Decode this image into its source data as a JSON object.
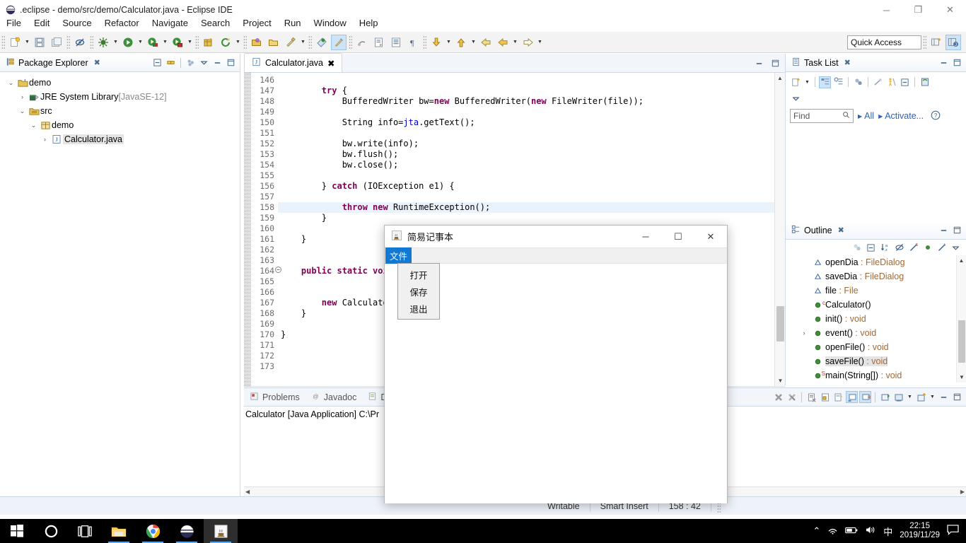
{
  "window": {
    "title": ".eclipse - demo/src/demo/Calculator.java - Eclipse IDE",
    "minimize": "─",
    "restore": "❐",
    "close": "✕"
  },
  "menubar": {
    "items": [
      "File",
      "Edit",
      "Source",
      "Refactor",
      "Navigate",
      "Search",
      "Project",
      "Run",
      "Window",
      "Help"
    ]
  },
  "toolbar": {
    "quick_access": "Quick Access",
    "icons": [
      "new-file-icon",
      "new-dropdown-arrow",
      "save-icon",
      "save-all-icon",
      "toggle-breakpoint-icon",
      "debug-icon",
      "debug-dropdown-arrow",
      "run-icon",
      "run-dropdown-arrow",
      "run-coverage-icon",
      "coverage-dropdown-arrow",
      "external-tools-icon",
      "tools-dropdown-arrow",
      "new-java-project-icon",
      "refresh-icon",
      "refresh-dropdown-arrow",
      "open-type-icon",
      "open-resource-icon",
      "search-icon",
      "search-dropdown-arrow",
      "link-editor-icon",
      "pin-editor-icon",
      "next-annotation-icon",
      "previous-annotation-icon",
      "mark-occurrences-icon",
      "show-whitespace-icon",
      "download-icon",
      "download-dropdown-arrow",
      "upload-icon",
      "upload-dropdown-arrow",
      "back-icon",
      "forward-icon",
      "forward-dropdown-arrow",
      "next-edit-icon",
      "next-dropdown-arrow",
      "perspective-new-icon",
      "perspective-java-icon"
    ]
  },
  "package_explorer": {
    "tab_label": "Package Explorer",
    "tools": [
      "collapse-all-icon",
      "link-with-editor-icon",
      "view-menu-filter-icon",
      "view-menu-icon",
      "minimize-icon",
      "maximize-icon"
    ],
    "tree": [
      {
        "label": "demo",
        "label2": "",
        "indent": 0,
        "twisty": "⌄",
        "icon": "project-folder-icon",
        "selected": false
      },
      {
        "label": "JRE System Library",
        "label2": "[JavaSE-12]",
        "indent": 1,
        "twisty": "›",
        "icon": "library-icon",
        "selected": false
      },
      {
        "label": "src",
        "label2": "",
        "indent": 1,
        "twisty": "⌄",
        "icon": "source-folder-icon",
        "selected": false
      },
      {
        "label": "demo",
        "label2": "",
        "indent": 2,
        "twisty": "⌄",
        "icon": "package-icon",
        "selected": false
      },
      {
        "label": "Calculator.java",
        "label2": "",
        "indent": 3,
        "twisty": "›",
        "icon": "java-file-icon",
        "selected": true
      }
    ]
  },
  "editor": {
    "tab_label": "Calculator.java",
    "tab_icon": "java-file-icon",
    "tab_close": "✖",
    "first_line_number": 146,
    "highlighted_line": 158,
    "folded_lines": [
      164
    ],
    "lines": [
      {
        "n": 146,
        "tokens": []
      },
      {
        "n": 147,
        "tokens": [
          {
            "t": "        ",
            "c": ""
          },
          {
            "t": "try",
            "c": "kw"
          },
          {
            "t": " {",
            "c": ""
          }
        ]
      },
      {
        "n": 148,
        "tokens": [
          {
            "t": "            BufferedWriter bw=",
            "c": ""
          },
          {
            "t": "new",
            "c": "kw"
          },
          {
            "t": " BufferedWriter(",
            "c": ""
          },
          {
            "t": "new",
            "c": "kw"
          },
          {
            "t": " FileWriter(file));",
            "c": ""
          }
        ]
      },
      {
        "n": 149,
        "tokens": []
      },
      {
        "n": 150,
        "tokens": [
          {
            "t": "            String info=",
            "c": ""
          },
          {
            "t": "jta",
            "c": "fld"
          },
          {
            "t": ".getText();",
            "c": ""
          }
        ]
      },
      {
        "n": 151,
        "tokens": []
      },
      {
        "n": 152,
        "tokens": [
          {
            "t": "            bw.write(",
            "c": ""
          },
          {
            "t": "info",
            "c": ""
          },
          {
            "t": ");",
            "c": ""
          }
        ]
      },
      {
        "n": 153,
        "tokens": [
          {
            "t": "            bw.flush();",
            "c": ""
          }
        ]
      },
      {
        "n": 154,
        "tokens": [
          {
            "t": "            bw.close();",
            "c": ""
          }
        ]
      },
      {
        "n": 155,
        "tokens": []
      },
      {
        "n": 156,
        "tokens": [
          {
            "t": "        } ",
            "c": ""
          },
          {
            "t": "catch",
            "c": "kw"
          },
          {
            "t": " (IOException e1) {",
            "c": ""
          }
        ]
      },
      {
        "n": 157,
        "tokens": []
      },
      {
        "n": 158,
        "tokens": [
          {
            "t": "            ",
            "c": ""
          },
          {
            "t": "throw new",
            "c": "kw"
          },
          {
            "t": " RuntimeException();",
            "c": ""
          }
        ]
      },
      {
        "n": 159,
        "tokens": [
          {
            "t": "        }",
            "c": ""
          }
        ]
      },
      {
        "n": 160,
        "tokens": []
      },
      {
        "n": 161,
        "tokens": [
          {
            "t": "    }",
            "c": ""
          }
        ]
      },
      {
        "n": 162,
        "tokens": []
      },
      {
        "n": 163,
        "tokens": []
      },
      {
        "n": 164,
        "tokens": [
          {
            "t": "    ",
            "c": ""
          },
          {
            "t": "public static void",
            "c": "kw"
          },
          {
            "t": " ",
            "c": ""
          }
        ]
      },
      {
        "n": 165,
        "tokens": []
      },
      {
        "n": 166,
        "tokens": []
      },
      {
        "n": 167,
        "tokens": [
          {
            "t": "        ",
            "c": ""
          },
          {
            "t": "new",
            "c": "kw"
          },
          {
            "t": " Calculator",
            "c": ""
          }
        ]
      },
      {
        "n": 168,
        "tokens": [
          {
            "t": "    }",
            "c": ""
          }
        ]
      },
      {
        "n": 169,
        "tokens": []
      },
      {
        "n": 170,
        "tokens": [
          {
            "t": "}",
            "c": ""
          }
        ]
      },
      {
        "n": 171,
        "tokens": []
      },
      {
        "n": 172,
        "tokens": []
      },
      {
        "n": 173,
        "tokens": []
      }
    ]
  },
  "console": {
    "tabs": [
      {
        "label": "Problems",
        "icon": "problems-icon",
        "active": false
      },
      {
        "label": "Javadoc",
        "icon": "javadoc-icon",
        "active": false
      },
      {
        "label": "De",
        "icon": "declaration-icon",
        "active": false
      }
    ],
    "launch_line": "Calculator [Java Application] C:\\Pr",
    "tools": [
      "terminate-icon",
      "terminate-all-icon",
      "remove-launch-icon",
      "lock-scroll-icon",
      "scroll-lock-icon",
      "show-console-stdout-icon",
      "show-console-stderr-icon",
      "open-console-icon",
      "display-selected-console-icon",
      "console-dropdown-arrow",
      "new-console-view-icon",
      "new-console-dropdown-arrow",
      "minimize-icon",
      "maximize-icon"
    ]
  },
  "task_list": {
    "tab_label": "Task List",
    "tools": [
      "new-task-icon",
      "new-task-dropdown-arrow",
      "categorized-presentation-icon",
      "scheduled-presentation-icon",
      "synchronize-icon",
      "focus-on-workweek-icon",
      "collapse-all-icon",
      "minimize-view-icon",
      "restore-icon",
      "view-menu-icon"
    ],
    "find_placeholder": "Find",
    "search_icon": "search-icon",
    "links": [
      "All",
      "Activate..."
    ],
    "help_icon": "help-icon"
  },
  "outline": {
    "tab_label": "Outline",
    "tools": [
      "focus-on-active-task-icon",
      "collapse-all-icon",
      "sort-icon",
      "hide-fields-icon",
      "hide-static-icon",
      "hide-non-public-icon",
      "hide-local-types-icon",
      "view-menu-icon"
    ],
    "items": [
      {
        "name": "openDia",
        "sep": " : ",
        "type": "FileDialog",
        "kind": "field",
        "badge": "",
        "twisty": "",
        "selected": false
      },
      {
        "name": "saveDia",
        "sep": " : ",
        "type": "FileDialog",
        "kind": "field",
        "badge": "",
        "twisty": "",
        "selected": false
      },
      {
        "name": "file",
        "sep": " : ",
        "type": "File",
        "kind": "field",
        "badge": "",
        "twisty": "",
        "selected": false
      },
      {
        "name": "Calculator()",
        "sep": "",
        "type": "",
        "kind": "method",
        "badge": "c",
        "twisty": "",
        "selected": false
      },
      {
        "name": "init()",
        "sep": " : ",
        "type": "void",
        "kind": "method",
        "badge": "",
        "twisty": "",
        "selected": false
      },
      {
        "name": "event()",
        "sep": " : ",
        "type": "void",
        "kind": "method",
        "badge": "",
        "twisty": "›",
        "selected": false
      },
      {
        "name": "openFile()",
        "sep": " : ",
        "type": "void",
        "kind": "method",
        "badge": "",
        "twisty": "",
        "selected": false
      },
      {
        "name": "saveFile()",
        "sep": " : ",
        "type": "void",
        "kind": "method",
        "badge": "",
        "twisty": "",
        "selected": true
      },
      {
        "name": "main(String[])",
        "sep": " : ",
        "type": "void",
        "kind": "method",
        "badge": "S",
        "twisty": "",
        "selected": false
      }
    ]
  },
  "statusbar": {
    "writable": "Writable",
    "insert_mode": "Smart Insert",
    "position": "158 : 42"
  },
  "java_dialog": {
    "title": "简易记事本",
    "icon": "java-coffee-cup-icon",
    "minimize": "─",
    "maximize": "☐",
    "close": "✕",
    "menu_label": "文件",
    "menu_items": [
      "打开",
      "保存",
      "退出"
    ]
  },
  "taskbar": {
    "buttons": [
      {
        "name": "start-button",
        "icon": "windows-logo-icon",
        "active": false,
        "running": false
      },
      {
        "name": "cortana-button",
        "icon": "cortana-circle-icon",
        "active": false,
        "running": false
      },
      {
        "name": "task-view-button",
        "icon": "task-view-icon",
        "active": false,
        "running": false
      },
      {
        "name": "file-explorer-button",
        "icon": "folder-icon",
        "active": false,
        "running": true
      },
      {
        "name": "chrome-button",
        "icon": "chrome-icon",
        "active": false,
        "running": true
      },
      {
        "name": "eclipse-button",
        "icon": "eclipse-icon",
        "active": false,
        "running": true
      },
      {
        "name": "java-app-button",
        "icon": "java-coffee-cup-icon",
        "active": true,
        "running": true
      }
    ],
    "tray": {
      "overflow": "⌃",
      "network_icon": "wifi-icon",
      "battery_icon": "battery-icon",
      "volume_icon": "speaker-icon",
      "ime": "中",
      "time": "22:15",
      "date": "2019/11/29",
      "action_center_icon": "notification-icon"
    }
  },
  "colors": {
    "accent_blue": "#1178d4",
    "keyword_purple": "#7f0055",
    "field_blue": "#0000c0",
    "type_brown": "#a06a3a",
    "link_blue": "#2b63b5"
  }
}
